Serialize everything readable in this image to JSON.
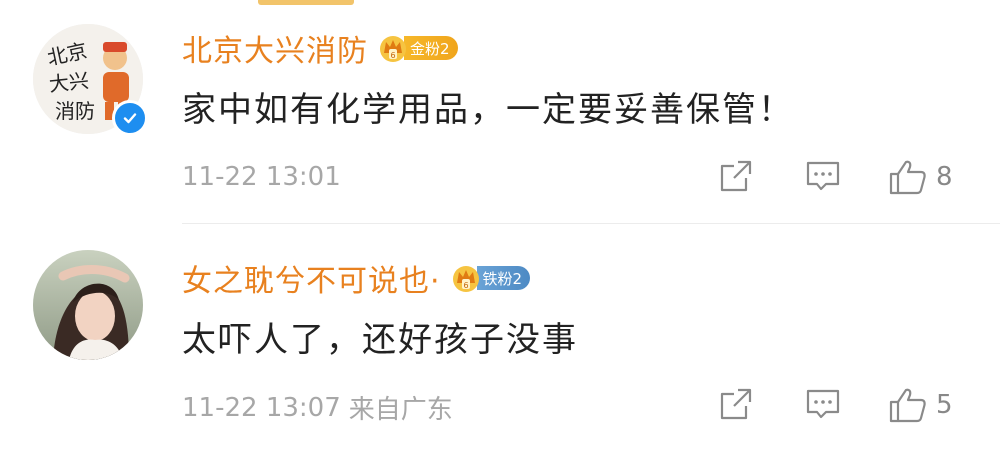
{
  "comments": [
    {
      "username": "北京大兴消防",
      "fan_badge": {
        "label": "金粉2",
        "tier": "gold"
      },
      "verified": true,
      "text": "家中如有化学用品，一定要妥善保管！",
      "timestamp": "11-22 13:01",
      "location": "",
      "likes": "8",
      "avatar": {
        "text_lines": [
          "北京",
          "大兴",
          "消防"
        ]
      }
    },
    {
      "username": "女之耽兮不可说也·",
      "fan_badge": {
        "label": "铁粉2",
        "tier": "iron"
      },
      "verified": false,
      "text": "太吓人了，还好孩子没事",
      "timestamp": "11-22 13:07",
      "location": "来自广东",
      "likes": "5"
    }
  ],
  "icons": {
    "share": "share-icon",
    "reply": "comment-icon",
    "like": "thumbs-up-icon",
    "verified": "verified-check-icon",
    "fan_crown": "crown-icon"
  },
  "colors": {
    "username": "#e8811f",
    "text": "#222222",
    "meta": "#a7a7a7",
    "verified": "#1e8ef0",
    "gold_badge": "#f6b82a",
    "iron_badge": "#5b95cc"
  }
}
